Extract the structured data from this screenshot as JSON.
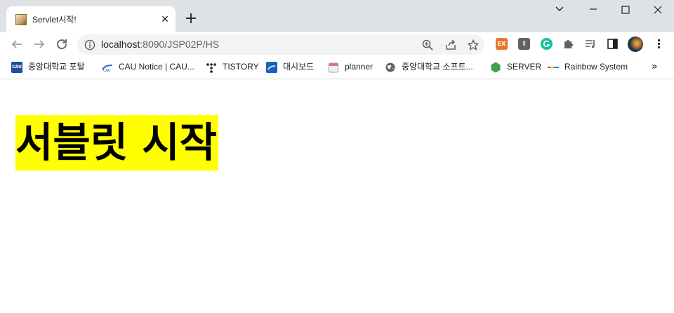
{
  "tab": {
    "title": "Servlet시작!",
    "close_glyph": "✕"
  },
  "new_tab_glyph": "+",
  "address_bar": {
    "host": "localhost",
    "path": ":8090/JSP02P/HS"
  },
  "bookmarks": [
    {
      "icon": "cau-portal-icon",
      "label": "중앙대학교 포탈"
    },
    {
      "icon": "cau-notice-icon",
      "label": "CAU Notice | CAU..."
    },
    {
      "icon": "tistory-icon",
      "label": "TISTORY"
    },
    {
      "icon": "cau-dashboard-icon",
      "label": "대시보드"
    },
    {
      "icon": "calendar-icon",
      "label": "planner"
    },
    {
      "icon": "globe-icon",
      "label": "중앙대학교 소프트..."
    },
    {
      "icon": "server-icon",
      "label": "SERVER"
    },
    {
      "icon": "rainbow-icon",
      "label": "Rainbow System"
    }
  ],
  "bookmarks_overflow_glyph": "»",
  "extensions": [
    {
      "icon": "ex-extension-icon",
      "label": "EX",
      "color": "#e8772e"
    },
    {
      "icon": "i-extension-icon",
      "label": "I",
      "color": "#5f6368"
    },
    {
      "icon": "grammarly-icon",
      "label": "",
      "color": "#15c39a"
    }
  ],
  "page": {
    "heading": "서블릿 시작",
    "highlight_color": "#ffff00"
  }
}
